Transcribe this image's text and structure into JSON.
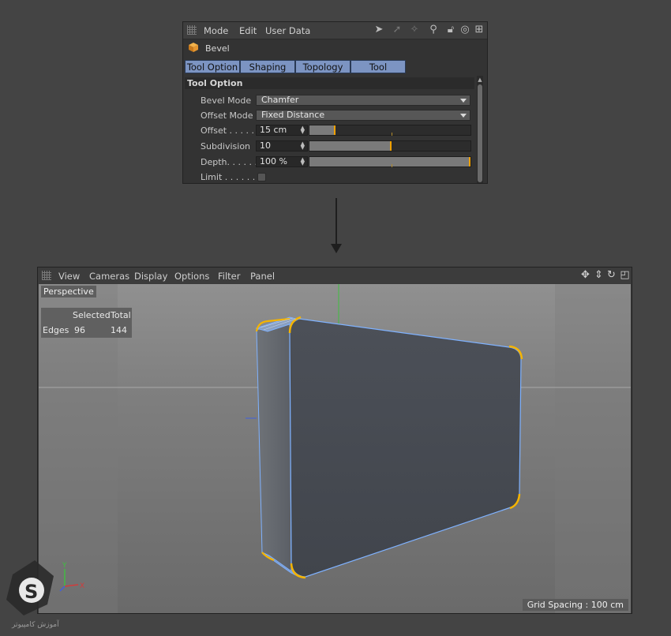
{
  "attr_panel": {
    "menu": [
      "Mode",
      "Edit",
      "User Data"
    ],
    "object_name": "Bevel",
    "tabs": [
      "Tool Option",
      "Shaping",
      "Topology",
      "Tool"
    ],
    "section_title": "Tool Option",
    "fields": {
      "bevel_mode": {
        "label": "Bevel Mode",
        "value": "Chamfer"
      },
      "offset_mode": {
        "label": "Offset Mode",
        "value": "Fixed Distance"
      },
      "offset": {
        "label": "Offset . . . . .",
        "value": "15 cm",
        "slider_fraction": 0.15
      },
      "subdivision": {
        "label": "Subdivision",
        "value": "10",
        "slider_fraction": 0.5
      },
      "depth": {
        "label": "Depth. . . . . .",
        "value": "100 %",
        "slider_fraction": 1.0
      },
      "limit": {
        "label": "Limit . . . . . .",
        "checked": false
      }
    },
    "toolbar_icons": [
      "arrow-left-icon",
      "arrow-up-icon",
      "arrow-right-icon",
      "search-icon",
      "lock-icon",
      "target-icon",
      "new-panel-icon"
    ]
  },
  "viewport": {
    "menu": [
      "View",
      "Cameras",
      "Display",
      "Options",
      "Filter",
      "Panel"
    ],
    "camera_label": "Perspective",
    "stats": {
      "col_selected": "Selected",
      "col_total": "Total",
      "row_label": "Edges",
      "selected": "96",
      "total": "144"
    },
    "grid_spacing": "Grid Spacing : 100 cm",
    "axis_labels": {
      "x": "X",
      "y": "Y"
    },
    "nav_icons": [
      "move-icon",
      "pan-icon",
      "rotate-icon",
      "maximize-icon"
    ]
  },
  "watermark": "آموزش کامپیوتر",
  "colors": {
    "tab_active": "#7c94c2",
    "slider_knob": "#f0a000",
    "selection_highlight": "#f5b400",
    "edge_blue": "#7fb2ff",
    "axis_green": "#3fbf3f",
    "axis_red": "#d33b3b",
    "axis_blue": "#3f5fe0"
  }
}
